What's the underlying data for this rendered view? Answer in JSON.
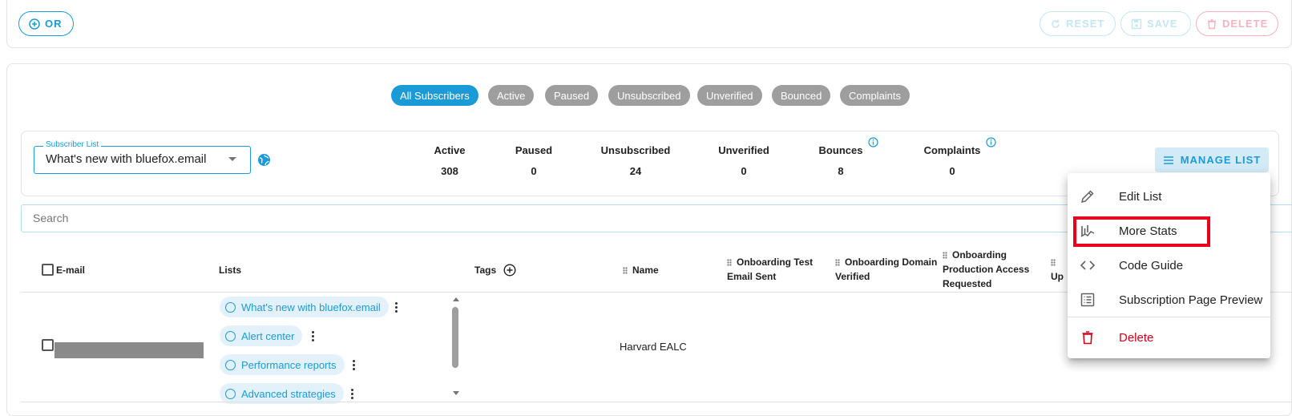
{
  "toolbar": {
    "or_label": "OR",
    "reset_label": "RESET",
    "save_label": "SAVE",
    "delete_label": "DELETE"
  },
  "filters": [
    {
      "label": "All Subscribers",
      "active": true
    },
    {
      "label": "Active",
      "active": false
    },
    {
      "label": "Paused",
      "active": false
    },
    {
      "label": "Unsubscribed",
      "active": false
    },
    {
      "label": "Unverified",
      "active": false
    },
    {
      "label": "Bounced",
      "active": false
    },
    {
      "label": "Complaints",
      "active": false
    }
  ],
  "subscriber_list": {
    "label": "Subscriber List",
    "value": "What's new with bluefox.email"
  },
  "stats": [
    {
      "label": "Active",
      "value": "308"
    },
    {
      "label": "Paused",
      "value": "0"
    },
    {
      "label": "Unsubscribed",
      "value": "24"
    },
    {
      "label": "Unverified",
      "value": "0"
    },
    {
      "label": "Bounces",
      "value": "8"
    },
    {
      "label": "Complaints",
      "value": "0"
    }
  ],
  "manage_list_label": "MANAGE LIST",
  "search": {
    "placeholder": "Search"
  },
  "table": {
    "headers": {
      "email": "E-mail",
      "lists": "Lists",
      "tags": "Tags",
      "name": "Name",
      "onboarding_test": "Onboarding Test Email Sent",
      "onboarding_domain": "Onboarding Domain Verified",
      "onboarding_production": "Onboarding Production Access Requested",
      "onboarding_up": "Up"
    },
    "row": {
      "lists": [
        "What's new with bluefox.email",
        "Alert center",
        "Performance reports",
        "Advanced strategies"
      ],
      "name": "Harvard EALC"
    }
  },
  "menu": {
    "items": [
      {
        "label": "Edit List",
        "icon": "pencil-icon"
      },
      {
        "label": "More Stats",
        "icon": "stats-chart-icon"
      },
      {
        "label": "Code Guide",
        "icon": "code-icon"
      },
      {
        "label": "Subscription Page Preview",
        "icon": "list-preview-icon"
      },
      {
        "label": "Delete",
        "icon": "trash-icon"
      }
    ]
  },
  "colors": {
    "accent": "#1a9bd7",
    "chip_inactive": "#9e9e9e",
    "danger": "#d0021b",
    "highlight": "#e8001c"
  }
}
